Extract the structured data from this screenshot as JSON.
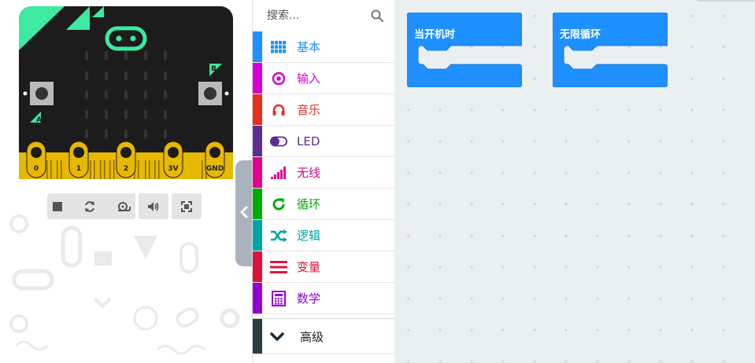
{
  "simulator": {
    "pins": [
      "0",
      "1",
      "2",
      "3V",
      "GND"
    ],
    "button_a_label": "A",
    "button_b_label": "B",
    "colors": {
      "board": "#1c1c1c",
      "accent": "#3eeaa0",
      "pins": "#e6b800"
    },
    "controls": [
      "stop-icon",
      "restart-icon",
      "slow-motion-icon",
      "sound-icon",
      "fullscreen-icon"
    ]
  },
  "toolbox": {
    "search_placeholder": "搜索...",
    "categories": [
      {
        "label": "基本",
        "color": "#1e90ff",
        "icon": "grid-icon"
      },
      {
        "label": "输入",
        "color": "#d400d4",
        "icon": "target-icon"
      },
      {
        "label": "音乐",
        "color": "#e63022",
        "icon": "headphones-icon"
      },
      {
        "label": "LED",
        "color": "#5c2d91",
        "icon": "toggle-icon"
      },
      {
        "label": "无线",
        "color": "#e3008c",
        "icon": "signal-icon"
      },
      {
        "label": "循环",
        "color": "#00aa00",
        "icon": "refresh-icon"
      },
      {
        "label": "逻辑",
        "color": "#00a4a6",
        "icon": "shuffle-icon"
      },
      {
        "label": "变量",
        "color": "#dc143c",
        "icon": "list-icon"
      },
      {
        "label": "数学",
        "color": "#9400d3",
        "icon": "calculator-icon"
      }
    ],
    "advanced": {
      "label": "高级",
      "icon": "chevron-down-icon"
    }
  },
  "workspace": {
    "blocks": [
      {
        "label": "当开机时",
        "color": "#1e90ff"
      },
      {
        "label": "无限循环",
        "color": "#1e90ff"
      }
    ]
  }
}
